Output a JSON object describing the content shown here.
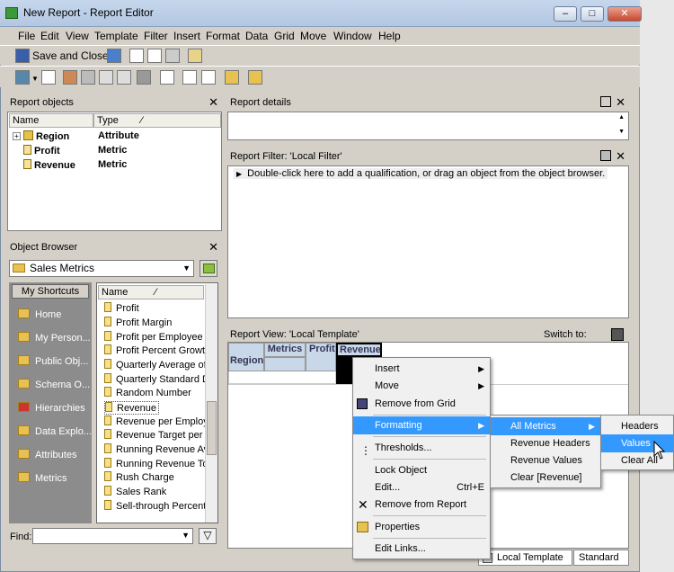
{
  "window": {
    "title": "New Report - Report Editor"
  },
  "menubar": [
    "File",
    "Edit",
    "View",
    "Template",
    "Filter",
    "Insert",
    "Format",
    "Data",
    "Grid",
    "Move",
    "Window",
    "Help"
  ],
  "toolbar": {
    "save_label": "Save and Close"
  },
  "report_objects": {
    "title": "Report objects",
    "col_name": "Name",
    "col_type": "Type",
    "rows": [
      {
        "name": "Region",
        "type": "Attribute"
      },
      {
        "name": "Profit",
        "type": "Metric"
      },
      {
        "name": "Revenue",
        "type": "Metric"
      }
    ]
  },
  "object_browser": {
    "title": "Object Browser",
    "folder": "Sales Metrics",
    "shortcuts_label": "My Shortcuts",
    "shortcuts": [
      "Home",
      "My Person...",
      "Public Obj...",
      "Schema O...",
      "Hierarchies",
      "Data Explo...",
      "Attributes",
      "Metrics"
    ],
    "list_header": "Name",
    "items": [
      "Profit",
      "Profit Margin",
      "Profit per Employee",
      "Profit Percent Growt",
      "Quarterly Average of",
      "Quarterly Standard D",
      "Random Number",
      "Revenue",
      "Revenue per Employ",
      "Revenue Target per I",
      "Running Revenue Av",
      "Running Revenue To",
      "Rush Charge",
      "Sales Rank",
      "Sell-through Percent"
    ],
    "find_label": "Find:"
  },
  "report_details": {
    "title": "Report details"
  },
  "report_filter": {
    "title": "Report Filter: 'Local Filter'",
    "hint": "Double-click here to add a qualification, or drag an object from the object browser."
  },
  "report_view": {
    "title": "Report View: 'Local Template'",
    "switch_label": "Switch to:",
    "grid": {
      "metrics": "Metrics",
      "profit": "Profit",
      "revenue": "Revenue",
      "region": "Region"
    }
  },
  "context_menu": {
    "items": [
      "Insert",
      "Move",
      "Remove from Grid",
      "Formatting",
      "Thresholds...",
      "Lock Object",
      "Edit...",
      "Remove from Report",
      "Properties",
      "Edit Links..."
    ],
    "edit_shortcut": "Ctrl+E"
  },
  "formatting_submenu": [
    "All Metrics",
    "Revenue Headers",
    "Revenue Values",
    "Clear [Revenue]"
  ],
  "all_metrics_submenu": [
    "Headers",
    "Values",
    "Clear All"
  ],
  "bottom_tabs": {
    "local_template": "Local Template",
    "standard": "Standard"
  }
}
